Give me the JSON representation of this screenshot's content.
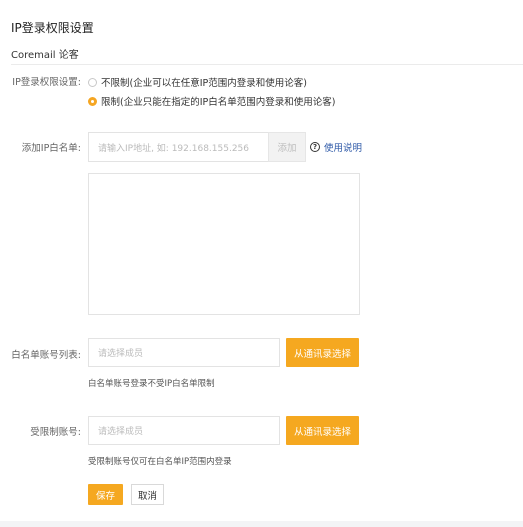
{
  "page": {
    "title": "IP登录权限设置",
    "section": "Coremail 论客"
  },
  "restriction": {
    "label": "IP登录权限设置:",
    "options": [
      {
        "label": "不限制(企业可以在任意IP范围内登录和使用论客)",
        "selected": false
      },
      {
        "label": "限制(企业只能在指定的IP白名单范围内登录和使用论客)",
        "selected": true
      }
    ]
  },
  "whitelist_ip": {
    "label": "添加IP白名单:",
    "placeholder": "请输入IP地址, 如: 192.168.155.256",
    "add_label": "添加",
    "help_label": "使用说明",
    "help_icon": "help-circle-icon"
  },
  "whitelist_accounts": {
    "label": "白名单账号列表:",
    "placeholder": "请选择成员",
    "select_label": "从通讯录选择",
    "hint": "白名单账号登录不受IP白名单限制"
  },
  "restricted_accounts": {
    "label": "受限制账号:",
    "placeholder": "请选择成员",
    "select_label": "从通讯录选择",
    "hint": "受限制账号仅可在白名单IP范围内登录"
  },
  "actions": {
    "save_label": "保存",
    "cancel_label": "取消"
  },
  "colors": {
    "accent": "#f5a820",
    "link": "#2f5aa8"
  }
}
